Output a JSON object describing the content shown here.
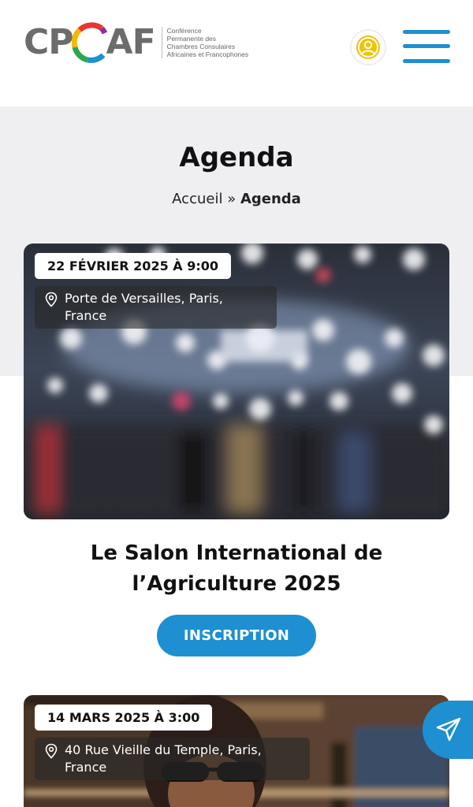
{
  "header": {
    "logo_left": "CP",
    "logo_right": "AF",
    "logo_subtitle_lines": [
      "Conférence",
      "Permanente des",
      "Chambres Consulaires",
      "Africaines et Francophones"
    ],
    "user_icon": "user-circle-icon",
    "menu_icon": "hamburger-menu-icon"
  },
  "page": {
    "title": "Agenda",
    "breadcrumb_home": "Accueil",
    "breadcrumb_sep": "»",
    "breadcrumb_current": "Agenda"
  },
  "events": [
    {
      "date": "22 FÉVRIER 2025 À 9:00",
      "location_line1": "Porte de Versailles, Paris,",
      "location_line2": "France",
      "title": "Le Salon International de l’Agriculture 2025",
      "button": "INSCRIPTION"
    },
    {
      "date": "14 MARS 2025 À 3:00",
      "location_line1": "40 Rue Vieille du Temple, Paris,",
      "location_line2": "France"
    }
  ],
  "fab": {
    "icon": "send-paper-plane-icon"
  },
  "colors": {
    "accent": "#1e8fd0",
    "band": "#efeff2",
    "user_icon": "#f2c200"
  }
}
